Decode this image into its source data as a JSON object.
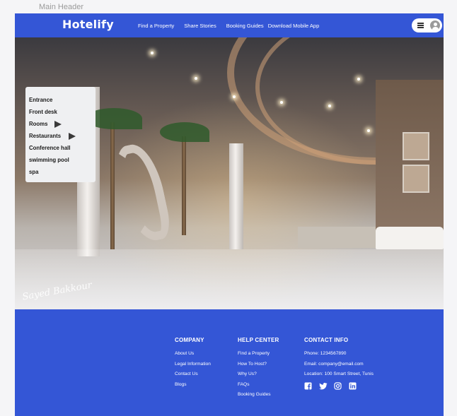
{
  "frame_label": "Main Header",
  "header": {
    "logo": "Hotelify",
    "nav": [
      "Find a Property",
      "Share Stories",
      "Booking Guides",
      "Download Mobile App"
    ]
  },
  "hero": {
    "signature": "Sayed Bakkour",
    "menu": [
      {
        "label": "Entrance",
        "has_submenu": false
      },
      {
        "label": "Front desk",
        "has_submenu": false
      },
      {
        "label": "Rooms",
        "has_submenu": true
      },
      {
        "label": "Restaurants",
        "has_submenu": true
      },
      {
        "label": "Conference hall",
        "has_submenu": false
      },
      {
        "label": "swimming pool",
        "has_submenu": false
      },
      {
        "label": "spa",
        "has_submenu": false
      }
    ]
  },
  "footer": {
    "company": {
      "title": "COMPANY",
      "links": [
        "About Us",
        "Legal Information",
        "Contact Us",
        "Blogs"
      ]
    },
    "help": {
      "title": "HELP CENTER",
      "links": [
        "Find a Property",
        "How To Host?",
        "Why Us?",
        "FAQs",
        "Booking Guides"
      ]
    },
    "contact": {
      "title": "CONTACT INFO",
      "phone": "Phone: 1234567890",
      "email": "Email: company@email.com",
      "location": "Location: 100 Smart Street, Tunis"
    },
    "socials": [
      "facebook-icon",
      "twitter-icon",
      "instagram-icon",
      "linkedin-icon"
    ]
  },
  "colors": {
    "brand": "#3456d6",
    "menu_bg": "#eff0f2"
  }
}
